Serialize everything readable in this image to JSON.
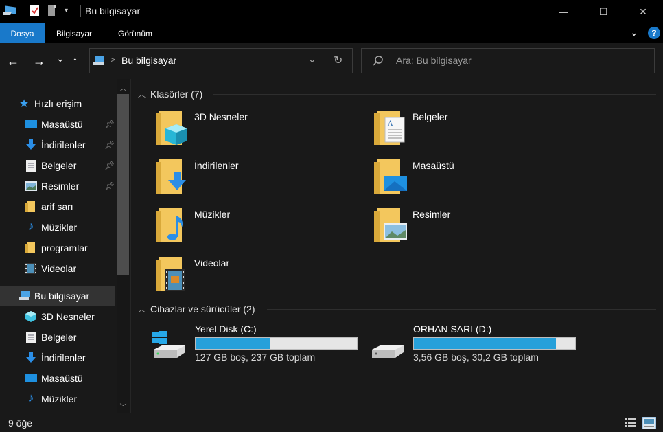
{
  "window": {
    "title": "Bu bilgisayar",
    "minimize_label": "—",
    "maximize_label": "☐",
    "close_label": "✕"
  },
  "ribbon": {
    "tabs": [
      {
        "label": "Dosya",
        "active": true
      },
      {
        "label": "Bilgisayar",
        "active": false
      },
      {
        "label": "Görünüm",
        "active": false
      }
    ],
    "help_label": "?"
  },
  "nav": {
    "back_label": "←",
    "forward_label": "→",
    "recent_label": "⌄",
    "up_label": "↑",
    "address_sep": ">",
    "address_path": "Bu bilgisayar",
    "refresh_label": "↻",
    "search_placeholder": "Ara: Bu bilgisayar"
  },
  "sidebar": {
    "items": [
      {
        "label": "Hızlı erişim",
        "icon": "star-icon",
        "pinned": false,
        "selected": false
      },
      {
        "label": "Masaüstü",
        "icon": "desktop-icon",
        "pinned": true,
        "selected": false
      },
      {
        "label": "İndirilenler",
        "icon": "download-icon",
        "pinned": true,
        "selected": false
      },
      {
        "label": "Belgeler",
        "icon": "documents-icon",
        "pinned": true,
        "selected": false
      },
      {
        "label": "Resimler",
        "icon": "pictures-icon",
        "pinned": true,
        "selected": false
      },
      {
        "label": "arif sarı",
        "icon": "folder-icon",
        "pinned": false,
        "selected": false
      },
      {
        "label": "Müzikler",
        "icon": "music-icon",
        "pinned": false,
        "selected": false
      },
      {
        "label": "programlar",
        "icon": "folder-icon",
        "pinned": false,
        "selected": false
      },
      {
        "label": "Videolar",
        "icon": "video-icon",
        "pinned": false,
        "selected": false
      },
      {
        "label": "Bu bilgisayar",
        "icon": "computer-icon",
        "pinned": false,
        "selected": true
      },
      {
        "label": "3D Nesneler",
        "icon": "cube-icon",
        "pinned": false,
        "selected": false
      },
      {
        "label": "Belgeler",
        "icon": "documents-icon",
        "pinned": false,
        "selected": false
      },
      {
        "label": "İndirilenler",
        "icon": "download-icon",
        "pinned": false,
        "selected": false
      },
      {
        "label": "Masaüstü",
        "icon": "desktop-icon",
        "pinned": false,
        "selected": false
      },
      {
        "label": "Müzikler",
        "icon": "music-icon",
        "pinned": false,
        "selected": false
      }
    ]
  },
  "content": {
    "folders_header": "Klasörler (7)",
    "folders": [
      {
        "label": "3D Nesneler",
        "icon": "cube-folder-icon"
      },
      {
        "label": "Belgeler",
        "icon": "documents-folder-icon"
      },
      {
        "label": "İndirilenler",
        "icon": "downloads-folder-icon"
      },
      {
        "label": "Masaüstü",
        "icon": "desktop-folder-icon"
      },
      {
        "label": "Müzikler",
        "icon": "music-folder-icon"
      },
      {
        "label": "Resimler",
        "icon": "pictures-folder-icon"
      },
      {
        "label": "Videolar",
        "icon": "videos-folder-icon"
      }
    ],
    "drives_header": "Cihazlar ve sürücüler (2)",
    "drives": [
      {
        "label": "Yerel Disk (C:)",
        "size_text": "127 GB boş, 237 GB toplam",
        "used_fraction": 0.46,
        "icon": "windows-drive-icon"
      },
      {
        "label": "ORHAN SARI (D:)",
        "size_text": "3,56 GB boş, 30,2 GB toplam",
        "used_fraction": 0.88,
        "icon": "drive-icon"
      }
    ]
  },
  "status": {
    "item_count": "9 öğe"
  },
  "colors": {
    "accent": "#1979ca",
    "drive_fill": "#26a0da",
    "folder": "#f3c75d"
  }
}
